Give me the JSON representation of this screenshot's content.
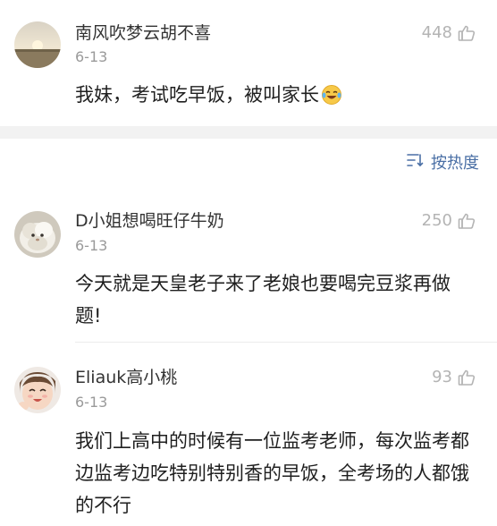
{
  "comments": [
    {
      "username": "南风吹梦云胡不喜",
      "date": "6-13",
      "likes": "448",
      "text": "我妹，考试吃早饭，被叫家长",
      "emoji": "crying-laughing-emoji"
    },
    {
      "username": "D小姐想喝旺仔牛奶",
      "date": "6-13",
      "likes": "250",
      "text": "今天就是天皇老子来了老娘也要喝完豆浆再做题!"
    },
    {
      "username": "Eliauk高小桃",
      "date": "6-13",
      "likes": "93",
      "text": "我们上高中的时候有一位监考老师，每次监考都边监考边吃特别特别香的早饭，全考场的人都饿的不行"
    }
  ],
  "sort": {
    "label": "按热度",
    "icon": "sort-icon"
  },
  "colors": {
    "accent": "#4a6fa5",
    "muted": "#9a9a9a",
    "separator": "#f2f2f2"
  }
}
